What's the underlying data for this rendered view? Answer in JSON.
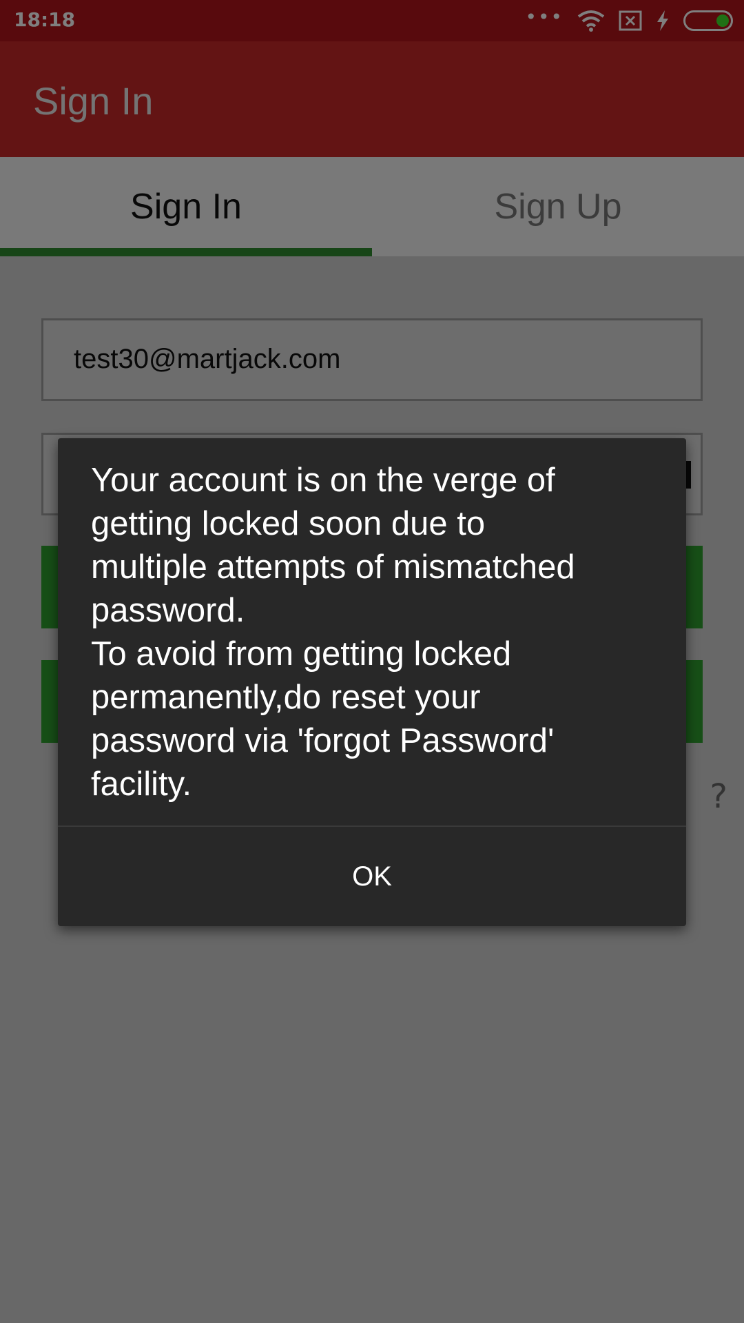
{
  "status_bar": {
    "time": "18:18",
    "icons": [
      "more-dots-icon",
      "wifi-icon",
      "sim-error-icon",
      "charging-bolt-icon",
      "battery-icon"
    ],
    "colors": {
      "background": "#b0141a",
      "battery_level": "#3fe02a"
    }
  },
  "app_bar": {
    "title": "Sign In",
    "color": "#c62828"
  },
  "tabs": [
    {
      "label": "Sign In",
      "selected": true
    },
    {
      "label": "Sign Up",
      "selected": false
    }
  ],
  "form": {
    "email_value": "test30@martjack.com",
    "partial_right_text": "?"
  },
  "dialog": {
    "message": "Your account is on the verge of\ngetting locked soon due to\nmultiple attempts of mismatched\npassword.\nTo avoid from getting locked\npermanently,do reset your\npassword via 'forgot Password'\nfacility.",
    "ok_label": "OK"
  },
  "colors": {
    "accent_green": "#2e8b2e",
    "dialog_background": "#282828"
  }
}
